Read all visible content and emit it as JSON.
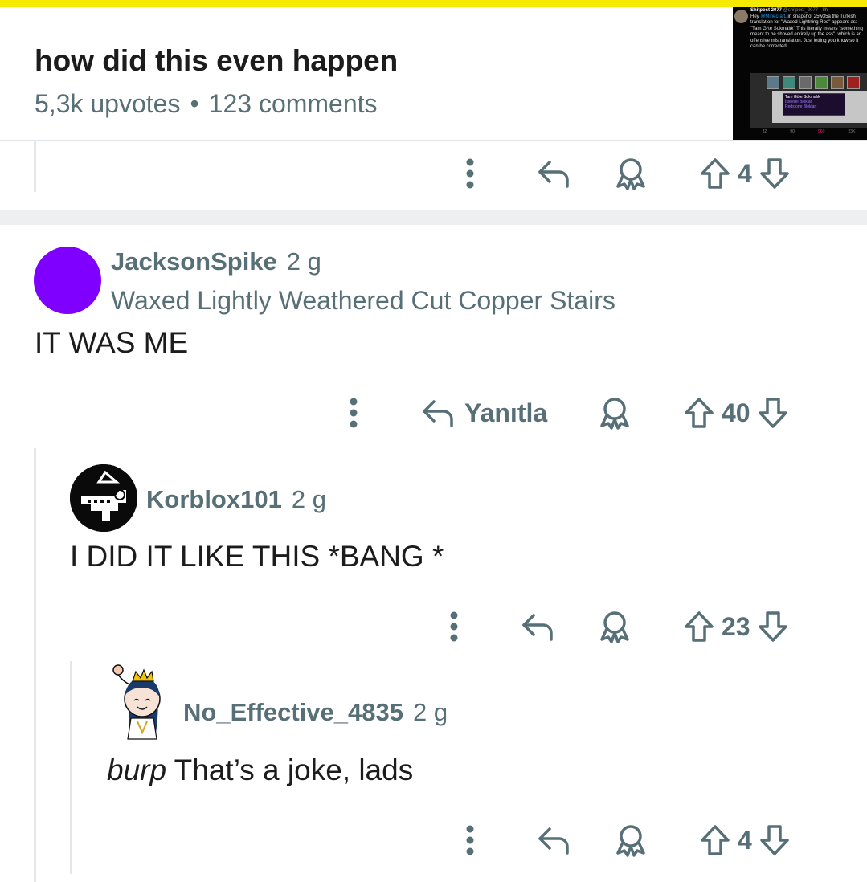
{
  "post": {
    "title": "how did this even happen",
    "upvotes": "5,3k upvotes",
    "separator": "•",
    "comments": "123 comments",
    "thumbnail": {
      "author": "Shitpost 2077",
      "handle": "@shitpost_2077 · 8h",
      "tweet_prefix": "Hey",
      "mention": "@Minecraft",
      "tweet_body": ", in snapshot 25w35a the Turkish translation for \"Waxed Lightning Rod\" appears as: \"Tam G*te Sokmalık\" This literally means \"something meant to be shoved entirely up the ass\", which is an offensive mistranslation. Just letting you know so it can be corrected.",
      "tooltip_title": "Tam Göte Sokmalık",
      "tooltip_line1": "İşlevsel Bloklar",
      "tooltip_line2": "Redstone Blokları",
      "stats": [
        "32",
        "90",
        "960",
        "23K"
      ]
    }
  },
  "top_action_row": {
    "votes": "4"
  },
  "comments": [
    {
      "username": "JacksonSpike",
      "age": "2 g",
      "flair": "Waxed Lightly Weathered Cut Copper Stairs",
      "body": "IT WAS ME",
      "reply_label": "Yanıtla",
      "votes": "40",
      "avatar_color": "#8000ff"
    },
    {
      "username": "Korblox101",
      "age": "2 g",
      "body": "I DID IT LIKE THIS *BANG *",
      "votes": "23"
    },
    {
      "username": "No_Effective_4835",
      "age": "2 g",
      "body_emphasis": "burp",
      "body": " That’s a joke, lads",
      "votes": "4"
    }
  ],
  "icons": {
    "more": "more-vertical-icon",
    "reply": "reply-arrow-icon",
    "award": "award-icon",
    "upvote": "upvote-arrow-icon",
    "downvote": "downvote-arrow-icon"
  },
  "colors": {
    "accent_bar": "#f6ea00",
    "meta_text": "#576f76",
    "thread_line": "#e4e7ea"
  }
}
